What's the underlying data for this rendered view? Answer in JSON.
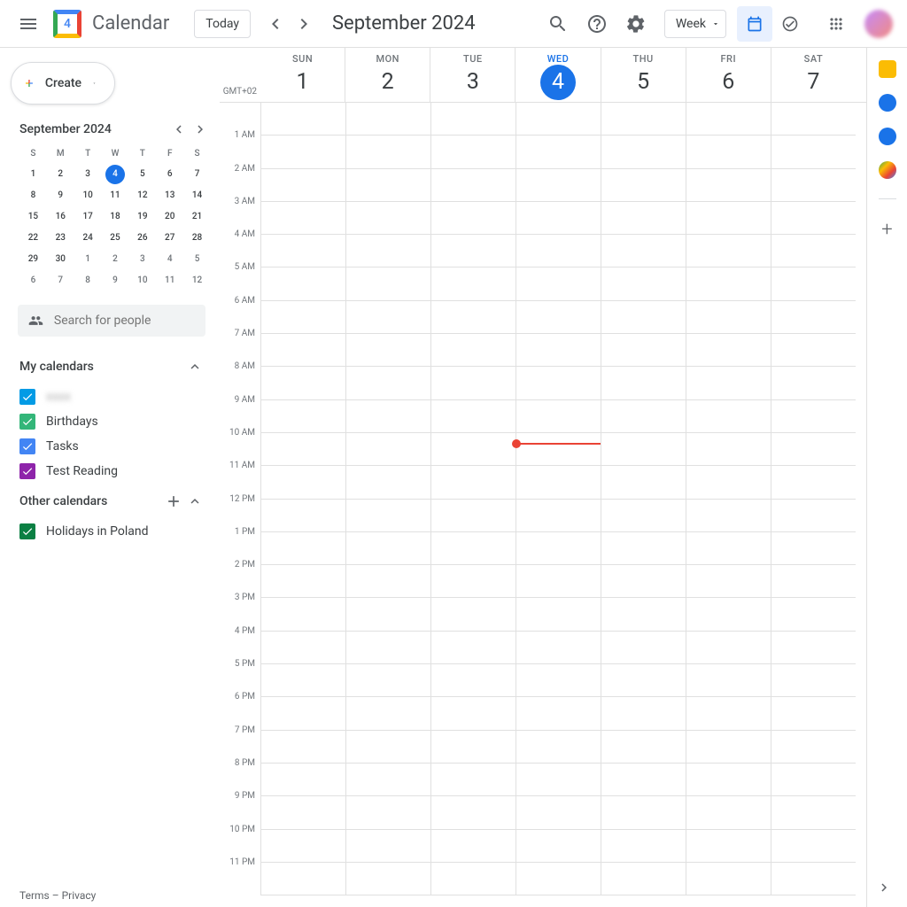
{
  "header": {
    "app_title": "Calendar",
    "logo_day": "4",
    "today_label": "Today",
    "month_title": "September 2024",
    "view_select": "Week"
  },
  "sidebar": {
    "create_label": "Create",
    "mini_cal": {
      "title": "September 2024",
      "day_headers": [
        "S",
        "M",
        "T",
        "W",
        "T",
        "F",
        "S"
      ],
      "weeks": [
        [
          {
            "n": "1"
          },
          {
            "n": "2"
          },
          {
            "n": "3"
          },
          {
            "n": "4",
            "today": true
          },
          {
            "n": "5"
          },
          {
            "n": "6"
          },
          {
            "n": "7"
          }
        ],
        [
          {
            "n": "8"
          },
          {
            "n": "9"
          },
          {
            "n": "10"
          },
          {
            "n": "11"
          },
          {
            "n": "12"
          },
          {
            "n": "13"
          },
          {
            "n": "14"
          }
        ],
        [
          {
            "n": "15"
          },
          {
            "n": "16"
          },
          {
            "n": "17"
          },
          {
            "n": "18"
          },
          {
            "n": "19"
          },
          {
            "n": "20"
          },
          {
            "n": "21"
          }
        ],
        [
          {
            "n": "22"
          },
          {
            "n": "23"
          },
          {
            "n": "24"
          },
          {
            "n": "25"
          },
          {
            "n": "26"
          },
          {
            "n": "27"
          },
          {
            "n": "28"
          }
        ],
        [
          {
            "n": "29"
          },
          {
            "n": "30"
          },
          {
            "n": "1",
            "muted": true
          },
          {
            "n": "2",
            "muted": true
          },
          {
            "n": "3",
            "muted": true
          },
          {
            "n": "4",
            "muted": true
          },
          {
            "n": "5",
            "muted": true
          }
        ],
        [
          {
            "n": "6",
            "muted": true
          },
          {
            "n": "7",
            "muted": true
          },
          {
            "n": "8",
            "muted": true
          },
          {
            "n": "9",
            "muted": true
          },
          {
            "n": "10",
            "muted": true
          },
          {
            "n": "11",
            "muted": true
          },
          {
            "n": "12",
            "muted": true
          }
        ]
      ]
    },
    "search_placeholder": "Search for people",
    "my_calendars_title": "My calendars",
    "my_calendars": [
      {
        "label": "",
        "color": "#039be5",
        "blurred": true
      },
      {
        "label": "Birthdays",
        "color": "#33b679"
      },
      {
        "label": "Tasks",
        "color": "#4285f4"
      },
      {
        "label": "Test Reading",
        "color": "#8e24aa"
      }
    ],
    "other_calendars_title": "Other calendars",
    "other_calendars": [
      {
        "label": "Holidays in Poland",
        "color": "#0b8043"
      }
    ]
  },
  "week_view": {
    "tz_label": "GMT+02",
    "days": [
      {
        "dow": "SUN",
        "num": "1"
      },
      {
        "dow": "MON",
        "num": "2"
      },
      {
        "dow": "TUE",
        "num": "3"
      },
      {
        "dow": "WED",
        "num": "4",
        "today": true
      },
      {
        "dow": "THU",
        "num": "5"
      },
      {
        "dow": "FRI",
        "num": "6"
      },
      {
        "dow": "SAT",
        "num": "7"
      }
    ],
    "hours": [
      "",
      "1 AM",
      "2 AM",
      "3 AM",
      "4 AM",
      "5 AM",
      "6 AM",
      "7 AM",
      "8 AM",
      "9 AM",
      "10 AM",
      "11 AM",
      "12 PM",
      "1 PM",
      "2 PM",
      "3 PM",
      "4 PM",
      "5 PM",
      "6 PM",
      "7 PM",
      "8 PM",
      "9 PM",
      "10 PM",
      "11 PM"
    ],
    "now_hour_fraction": 10.3,
    "now_day_index": 3
  },
  "footer": {
    "terms": "Terms",
    "sep": " – ",
    "privacy": "Privacy"
  },
  "side_panel_apps": [
    {
      "name": "keep-icon",
      "color": "#fbbc04"
    },
    {
      "name": "tasks-icon",
      "color": "#1a73e8"
    },
    {
      "name": "contacts-icon",
      "color": "#1a73e8"
    },
    {
      "name": "maps-icon",
      "color": "#34a853"
    }
  ]
}
